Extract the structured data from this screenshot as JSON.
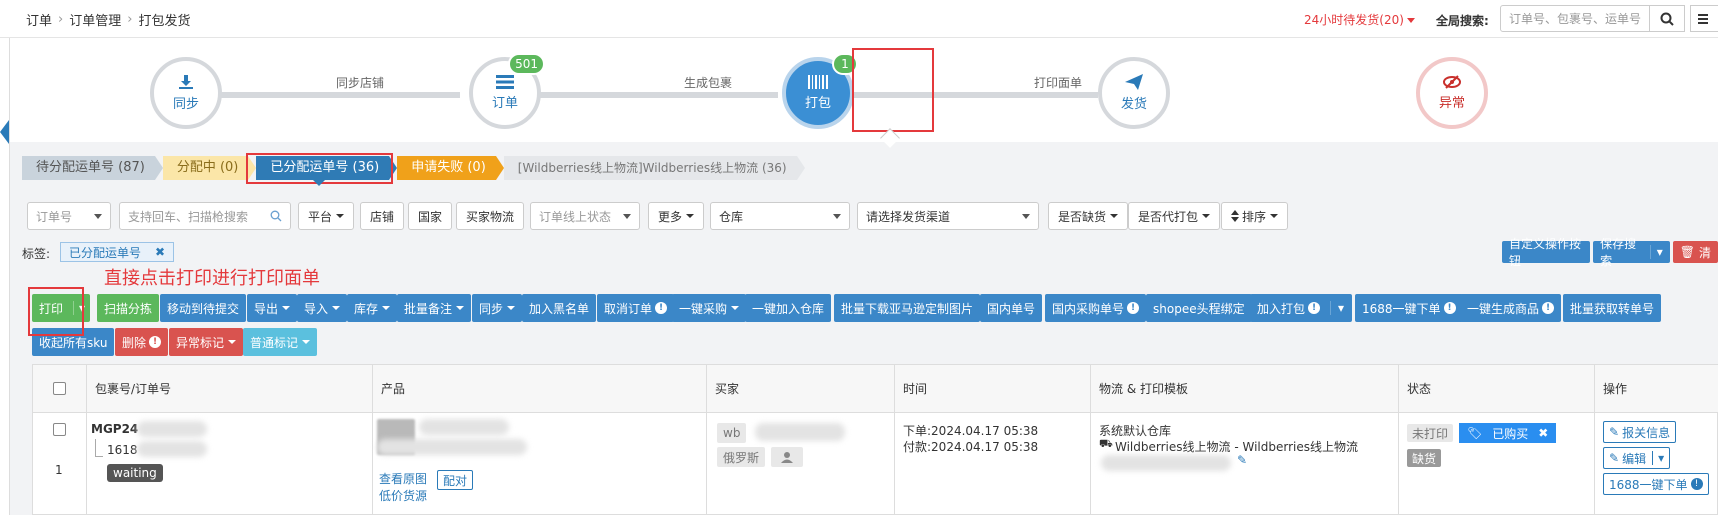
{
  "breadcrumb": [
    "订单",
    "订单管理",
    "打包发货"
  ],
  "header": {
    "urgent_label": "24小时待发货(20)",
    "global_search_label": "全局搜索:",
    "global_search_placeholder": "订单号、包裹号、运单号"
  },
  "flow": {
    "steps": [
      {
        "label": "同步",
        "icon": "download-icon",
        "badge": ""
      },
      {
        "label": "订单",
        "icon": "list-icon",
        "badge": "501"
      },
      {
        "label": "打包",
        "icon": "barcode-icon",
        "badge": "1"
      },
      {
        "label": "发货",
        "icon": "paper-plane-icon",
        "badge": ""
      },
      {
        "label": "异常",
        "icon": "eye-slash-icon",
        "badge": ""
      }
    ],
    "connectors": [
      "同步店铺",
      "生成包裹",
      "打印面单"
    ]
  },
  "subtabs": [
    "待分配运单号 (87)",
    "分配中 (0)",
    "已分配运单号 (36)",
    "申请失败 (0)",
    "[Wildberries线上物流]Wildberries线上物流 (36)"
  ],
  "filters": {
    "order_no": "订单号",
    "search_placeholder": "支持回车、扫描枪搜索",
    "platform": "平台",
    "shop": "店铺",
    "country": "国家",
    "buyer_logistics": "买家物流",
    "online_status": "订单线上状态",
    "more": "更多",
    "warehouse": "仓库",
    "channel": "请选择发货渠道",
    "out_of_stock": "是否缺货",
    "proxy_pack": "是否代打包",
    "sort": "排序"
  },
  "tags": {
    "label": "标签:",
    "active": "已分配运单号"
  },
  "right_buttons": [
    "自定义操作按钮",
    "保存搜索",
    "清"
  ],
  "hint": "直接点击打印进行打印面单",
  "actions_row1": [
    "打印",
    "扫描分拣",
    "移动到待提交",
    "导出",
    "导入",
    "库存",
    "批量备注",
    "同步",
    "加入黑名单",
    "取消订单",
    "一键采购",
    "一键加入仓库",
    "批量下载亚马逊定制图片",
    "国内单号",
    "国内采购单号",
    "shopee头程绑定",
    "加入打包",
    "1688一键下单",
    "一键生成商品",
    "批量获取转单号"
  ],
  "actions_row2": [
    "收起所有sku",
    "删除",
    "异常标记",
    "普通标记"
  ],
  "table": {
    "headers": [
      "包裹号/订单号",
      "产品",
      "买家",
      "时间",
      "物流 & 打印模板",
      "状态",
      "操作"
    ],
    "row": {
      "index": "1",
      "package_no": "MGP24",
      "order_no": "1618",
      "waiting": "waiting",
      "view_image": "查看原图",
      "low_price": "低价货源",
      "pair": "配对",
      "buyer_platform": "wb",
      "buyer_country": "俄罗斯",
      "order_time": "下单:2024.04.17 05:38",
      "pay_time": "付款:2024.04.17 05:38",
      "warehouse": "系统默认仓库",
      "logistics": "Wildberries线上物流 - Wildberries线上物流",
      "print_status": "未打印",
      "purchased": "已购买",
      "stock_status": "缺货",
      "op_customs": "报关信息",
      "op_edit": "编辑",
      "op_1688": "1688一键下单"
    }
  }
}
